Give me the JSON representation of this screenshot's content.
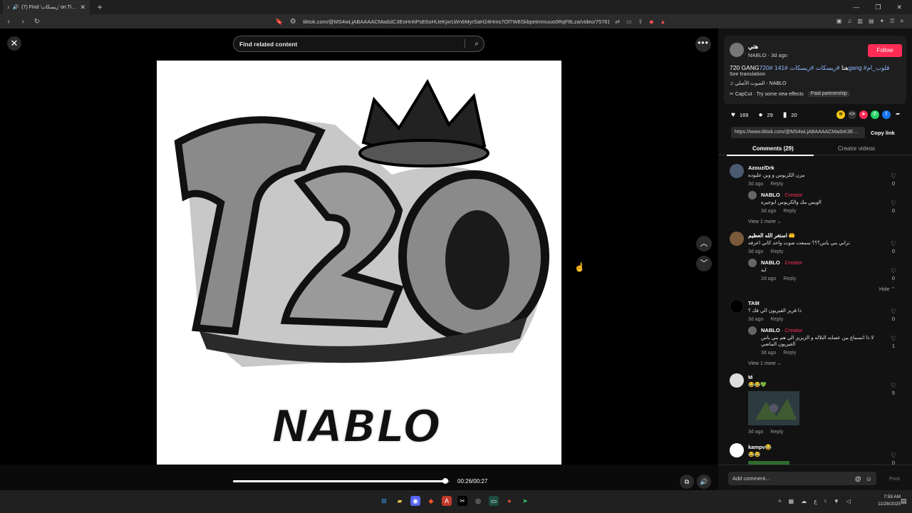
{
  "browser": {
    "tab_title": "(7) Find 'ريسكات' on TikTok | T",
    "url": "tiktok.com/@MS4wLjABAAAACMadslC3EoHnhPsE6oHUeKjxrLWn6MyrSaH24Hms7Of7W8Skbpetmmuuo0RqF8Lza/video/757618068850065..."
  },
  "search": {
    "placeholder": "Find related content"
  },
  "video": {
    "logo_text": "720",
    "artist_text": "NABLO",
    "progress_fraction": 0.98,
    "time": "00:26/00:27"
  },
  "post": {
    "author_name": "هتي",
    "author_meta": "NABLO · 3d ago",
    "follow_label": "Follow",
    "caption_main": "720 GANGهنا",
    "caption_tags": " #ريسكات #ريسكات #141 #720gang #قلوب_ام",
    "see_translation": "See translation",
    "music": "الصوت الأصلي - NABLO",
    "effect": "CapCut · Try some new effects",
    "paid": "Paid partnership",
    "likes": "169",
    "comments_count": "29",
    "saves": "20",
    "link": "https://www.tiktok.com/@MS4wLjABAAAACMadsK3E...",
    "copy_link": "Copy link"
  },
  "tabs": {
    "comments": "Comments (29)",
    "creator_videos": "Creator videos"
  },
  "comments": [
    {
      "name": "Azouz/Drk",
      "text": "مزن الكريوس و وين عليوده",
      "meta": "3d ago",
      "reply": "Reply",
      "likes": "0"
    },
    {
      "name": "NABLO",
      "creator": " · Creator",
      "text": "الويس مك والكريوس ابوجيره",
      "meta": "3d ago",
      "reply": "Reply",
      "likes": "0"
    },
    {
      "view_more": "View 1 more ⌄"
    },
    {
      "name": "استغر الله العظيم 🤲",
      "text": "تراني بني ياس؟؟؟ سمعت صوت واحد كاني اعرفه",
      "meta": "3d ago",
      "reply": "Reply",
      "likes": "0"
    },
    {
      "name": "NABLO",
      "creator": " · Creator",
      "text": "ايه",
      "meta": "2d ago",
      "reply": "Reply",
      "likes": "0"
    },
    {
      "hide": "Hide ⌃"
    },
    {
      "name": "TA9I",
      "text": "ذا قزيز الفيزيون الي فك ؟",
      "meta": "3d ago",
      "reply": "Reply",
      "likes": "0"
    },
    {
      "name": "NABLO",
      "creator": " · Creator",
      "text": "لا ذا اتسماع بين عصابه البلاله و الزيزيز الي هم بني ياس الفيزيون الماضي",
      "meta": "3d ago",
      "reply": "Reply",
      "likes": "1"
    },
    {
      "view_more": "View 1 more ⌄"
    },
    {
      "name": "M",
      "text": "😂😂💚",
      "meta": "3d ago",
      "reply": "Reply",
      "likes": "5"
    },
    {
      "name": "kampv😂",
      "text": "😂😂",
      "likes": "0"
    }
  ],
  "add_comment": {
    "placeholder": "Add comment...",
    "post": "Post"
  },
  "taskbar": {
    "time": "7:59 AM",
    "date": "11/28/2025"
  },
  "colors": {
    "accent": "#fe2c55",
    "panel": "#121212",
    "tag": "#8fb8ff"
  }
}
